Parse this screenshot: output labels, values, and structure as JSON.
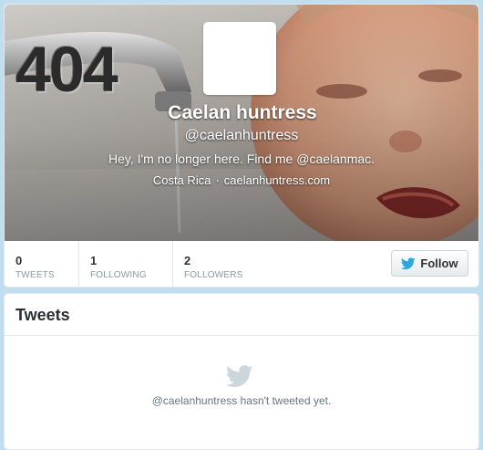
{
  "error_code": "404",
  "profile": {
    "full_name": "Caelan huntress",
    "screen_name": "@caelanhuntress",
    "bio": "Hey, I'm no longer here. Find me @caelanmac.",
    "location": "Costa Rica",
    "separator": "·",
    "website": "caelanhuntress.com"
  },
  "stats": {
    "tweets": {
      "count": "0",
      "label": "TWEETS"
    },
    "following": {
      "count": "1",
      "label": "FOLLOWING"
    },
    "followers": {
      "count": "2",
      "label": "FOLLOWERS"
    }
  },
  "follow_button": {
    "label": "Follow",
    "icon": "twitter-bird-icon"
  },
  "timeline": {
    "title": "Tweets",
    "empty_icon": "twitter-bird-icon",
    "empty_message": "@caelanhuntress hasn't tweeted yet."
  },
  "colors": {
    "page_background": "#c0deed",
    "bird_blue": "#2aa9e0",
    "text_dark": "#333333",
    "text_muted": "#8899a6"
  }
}
